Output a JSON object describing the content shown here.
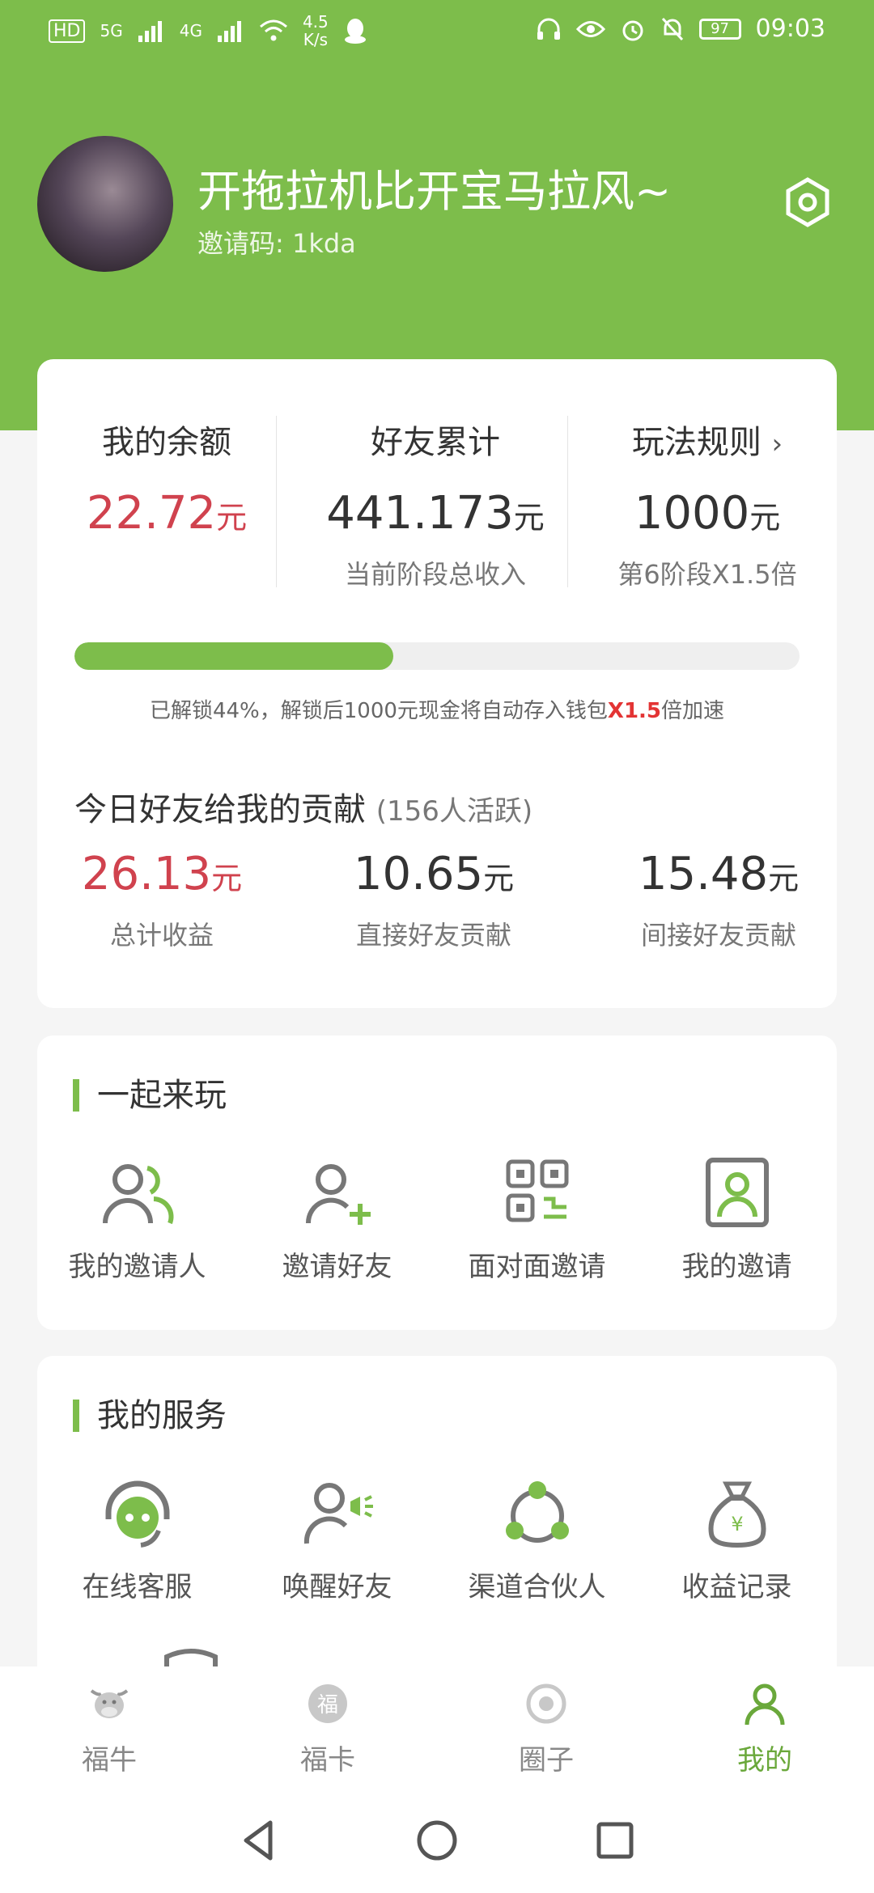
{
  "status_bar": {
    "hd": "HD",
    "signal1": "5G",
    "signal2": "4G",
    "speed_value": "4.5",
    "speed_unit": "K/s",
    "battery": "97",
    "time": "09:03"
  },
  "profile": {
    "username": "开拖拉机比开宝马拉风~",
    "invite_label": "邀请码: ",
    "invite_code": "1kda"
  },
  "balance_card": {
    "columns": [
      {
        "title": "我的余额",
        "value": "22.72",
        "unit": "元",
        "subtitle": ""
      },
      {
        "title": "好友累计",
        "value": "441.173",
        "unit": "元",
        "subtitle": "当前阶段总收入"
      },
      {
        "title": "玩法规则",
        "value": "1000",
        "unit": "元",
        "subtitle": "第6阶段X1.5倍"
      }
    ],
    "progress": 0.44,
    "note_prefix": "已解锁44%，解锁后1000元现金将自动存入钱包",
    "note_highlight": "X1.5",
    "note_suffix": "倍加速",
    "contrib_title": "今日好友给我的贡献",
    "contrib_active": "(156人活跃)",
    "contrib": [
      {
        "value": "26.13",
        "unit": "元",
        "label": "总计收益"
      },
      {
        "value": "10.65",
        "unit": "元",
        "label": "直接好友贡献"
      },
      {
        "value": "15.48",
        "unit": "元",
        "label": "间接好友贡献"
      }
    ]
  },
  "play_together": {
    "title": "一起来玩",
    "items": [
      {
        "label": "我的邀请人",
        "icon": "inviter-icon"
      },
      {
        "label": "邀请好友",
        "icon": "add-friend-icon"
      },
      {
        "label": "面对面邀请",
        "icon": "qr-code-icon"
      },
      {
        "label": "我的邀请",
        "icon": "my-invites-icon"
      }
    ]
  },
  "services": {
    "title": "我的服务",
    "items": [
      {
        "label": "在线客服",
        "icon": "headset-icon"
      },
      {
        "label": "唤醒好友",
        "icon": "wake-friend-icon"
      },
      {
        "label": "渠道合伙人",
        "icon": "partner-icon"
      },
      {
        "label": "收益记录",
        "icon": "money-bag-icon"
      }
    ]
  },
  "tabs": [
    {
      "label": "福牛",
      "icon": "cow-icon"
    },
    {
      "label": "福卡",
      "icon": "fu-card-icon"
    },
    {
      "label": "圈子",
      "icon": "circle-icon"
    },
    {
      "label": "我的",
      "icon": "user-icon",
      "active": true
    }
  ],
  "colors": {
    "brand_green": "#7dbd4b",
    "value_red": "#d0424e",
    "highlight_red": "#e33434"
  }
}
